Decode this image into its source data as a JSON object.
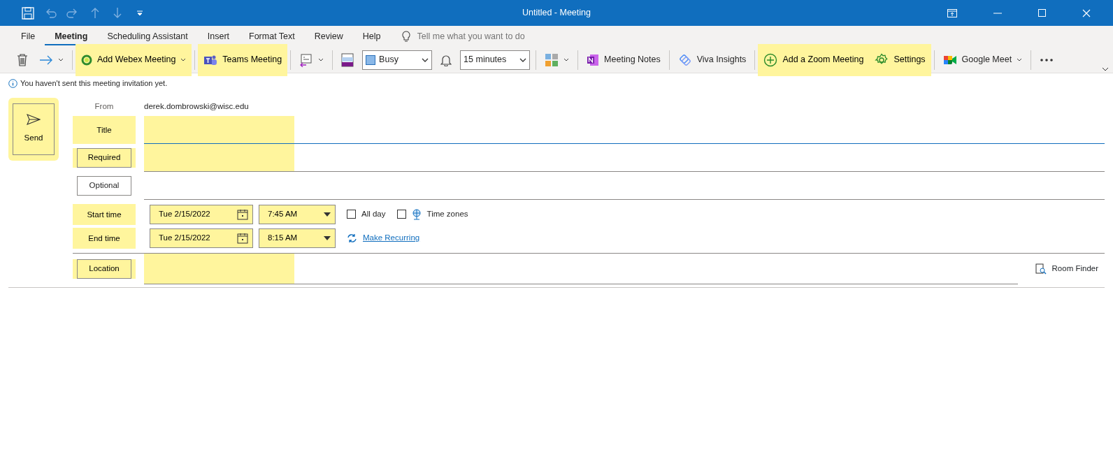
{
  "window": {
    "title": "Untitled  -  Meeting"
  },
  "menu_tabs": [
    {
      "label": "File",
      "selected": false
    },
    {
      "label": "Meeting",
      "selected": true
    },
    {
      "label": "Scheduling Assistant",
      "selected": false
    },
    {
      "label": "Insert",
      "selected": false
    },
    {
      "label": "Format Text",
      "selected": false
    },
    {
      "label": "Review",
      "selected": false
    },
    {
      "label": "Help",
      "selected": false
    }
  ],
  "tell_me": {
    "placeholder": "Tell me what you want to do"
  },
  "ribbon": [
    {
      "kind": "icon"
    },
    {
      "kind": "icon",
      "dropdown": true
    },
    {
      "kind": "sep"
    },
    {
      "kind": "button",
      "label": "Add Webex Meeting",
      "dropdown": true,
      "highlighted": true
    },
    {
      "kind": "sep"
    },
    {
      "kind": "button",
      "label": "Teams Meeting",
      "highlighted": true
    },
    {
      "kind": "sep"
    },
    {
      "kind": "icon",
      "dropdown": true
    },
    {
      "kind": "sep"
    },
    {
      "kind": "icon"
    },
    {
      "kind": "select",
      "value": "Busy"
    },
    {
      "kind": "icon"
    },
    {
      "kind": "select",
      "value": "15 minutes"
    },
    {
      "kind": "sep"
    },
    {
      "kind": "icon",
      "dropdown": true
    },
    {
      "kind": "sep"
    },
    {
      "kind": "button",
      "label": "Meeting Notes",
      "highlighted": false
    },
    {
      "kind": "sep"
    },
    {
      "kind": "button",
      "label": "Viva Insights",
      "highlighted": false
    },
    {
      "kind": "sep"
    },
    {
      "kind": "button",
      "label": "Add a Zoom Meeting",
      "highlighted": true
    },
    {
      "kind": "button",
      "label": "Settings",
      "highlighted": true
    },
    {
      "kind": "sep"
    },
    {
      "kind": "button",
      "label": "Google Meet",
      "dropdown": true,
      "highlighted": false
    },
    {
      "kind": "sep"
    },
    {
      "kind": "icon"
    }
  ],
  "info": "You haven't sent this meeting invitation yet.",
  "send": {
    "label": "Send",
    "highlighted": true
  },
  "from": {
    "label": "From",
    "value": "derek.dombrowski@wisc.edu"
  },
  "fields": [
    {
      "kind": "text",
      "label": "Title",
      "button": false,
      "highlighted": true,
      "focused": true
    },
    {
      "kind": "text",
      "label": "Required",
      "button": true,
      "highlighted": true,
      "focused": false
    },
    {
      "kind": "text",
      "label": "Optional",
      "button": true,
      "highlighted": false,
      "focused": false
    }
  ],
  "times": [
    {
      "label": "Start time",
      "date": "Tue 2/15/2022",
      "time": "7:45 AM",
      "highlighted": true
    },
    {
      "label": "End time",
      "date": "Tue 2/15/2022",
      "time": "8:15 AM",
      "highlighted": true
    }
  ],
  "all_day": {
    "label": "All day",
    "checked": false
  },
  "time_zones": {
    "label": "Time zones",
    "checked": false
  },
  "make_recurring": "Make Recurring",
  "location": {
    "label": "Location",
    "highlighted": true
  },
  "room_finder": "Room Finder"
}
